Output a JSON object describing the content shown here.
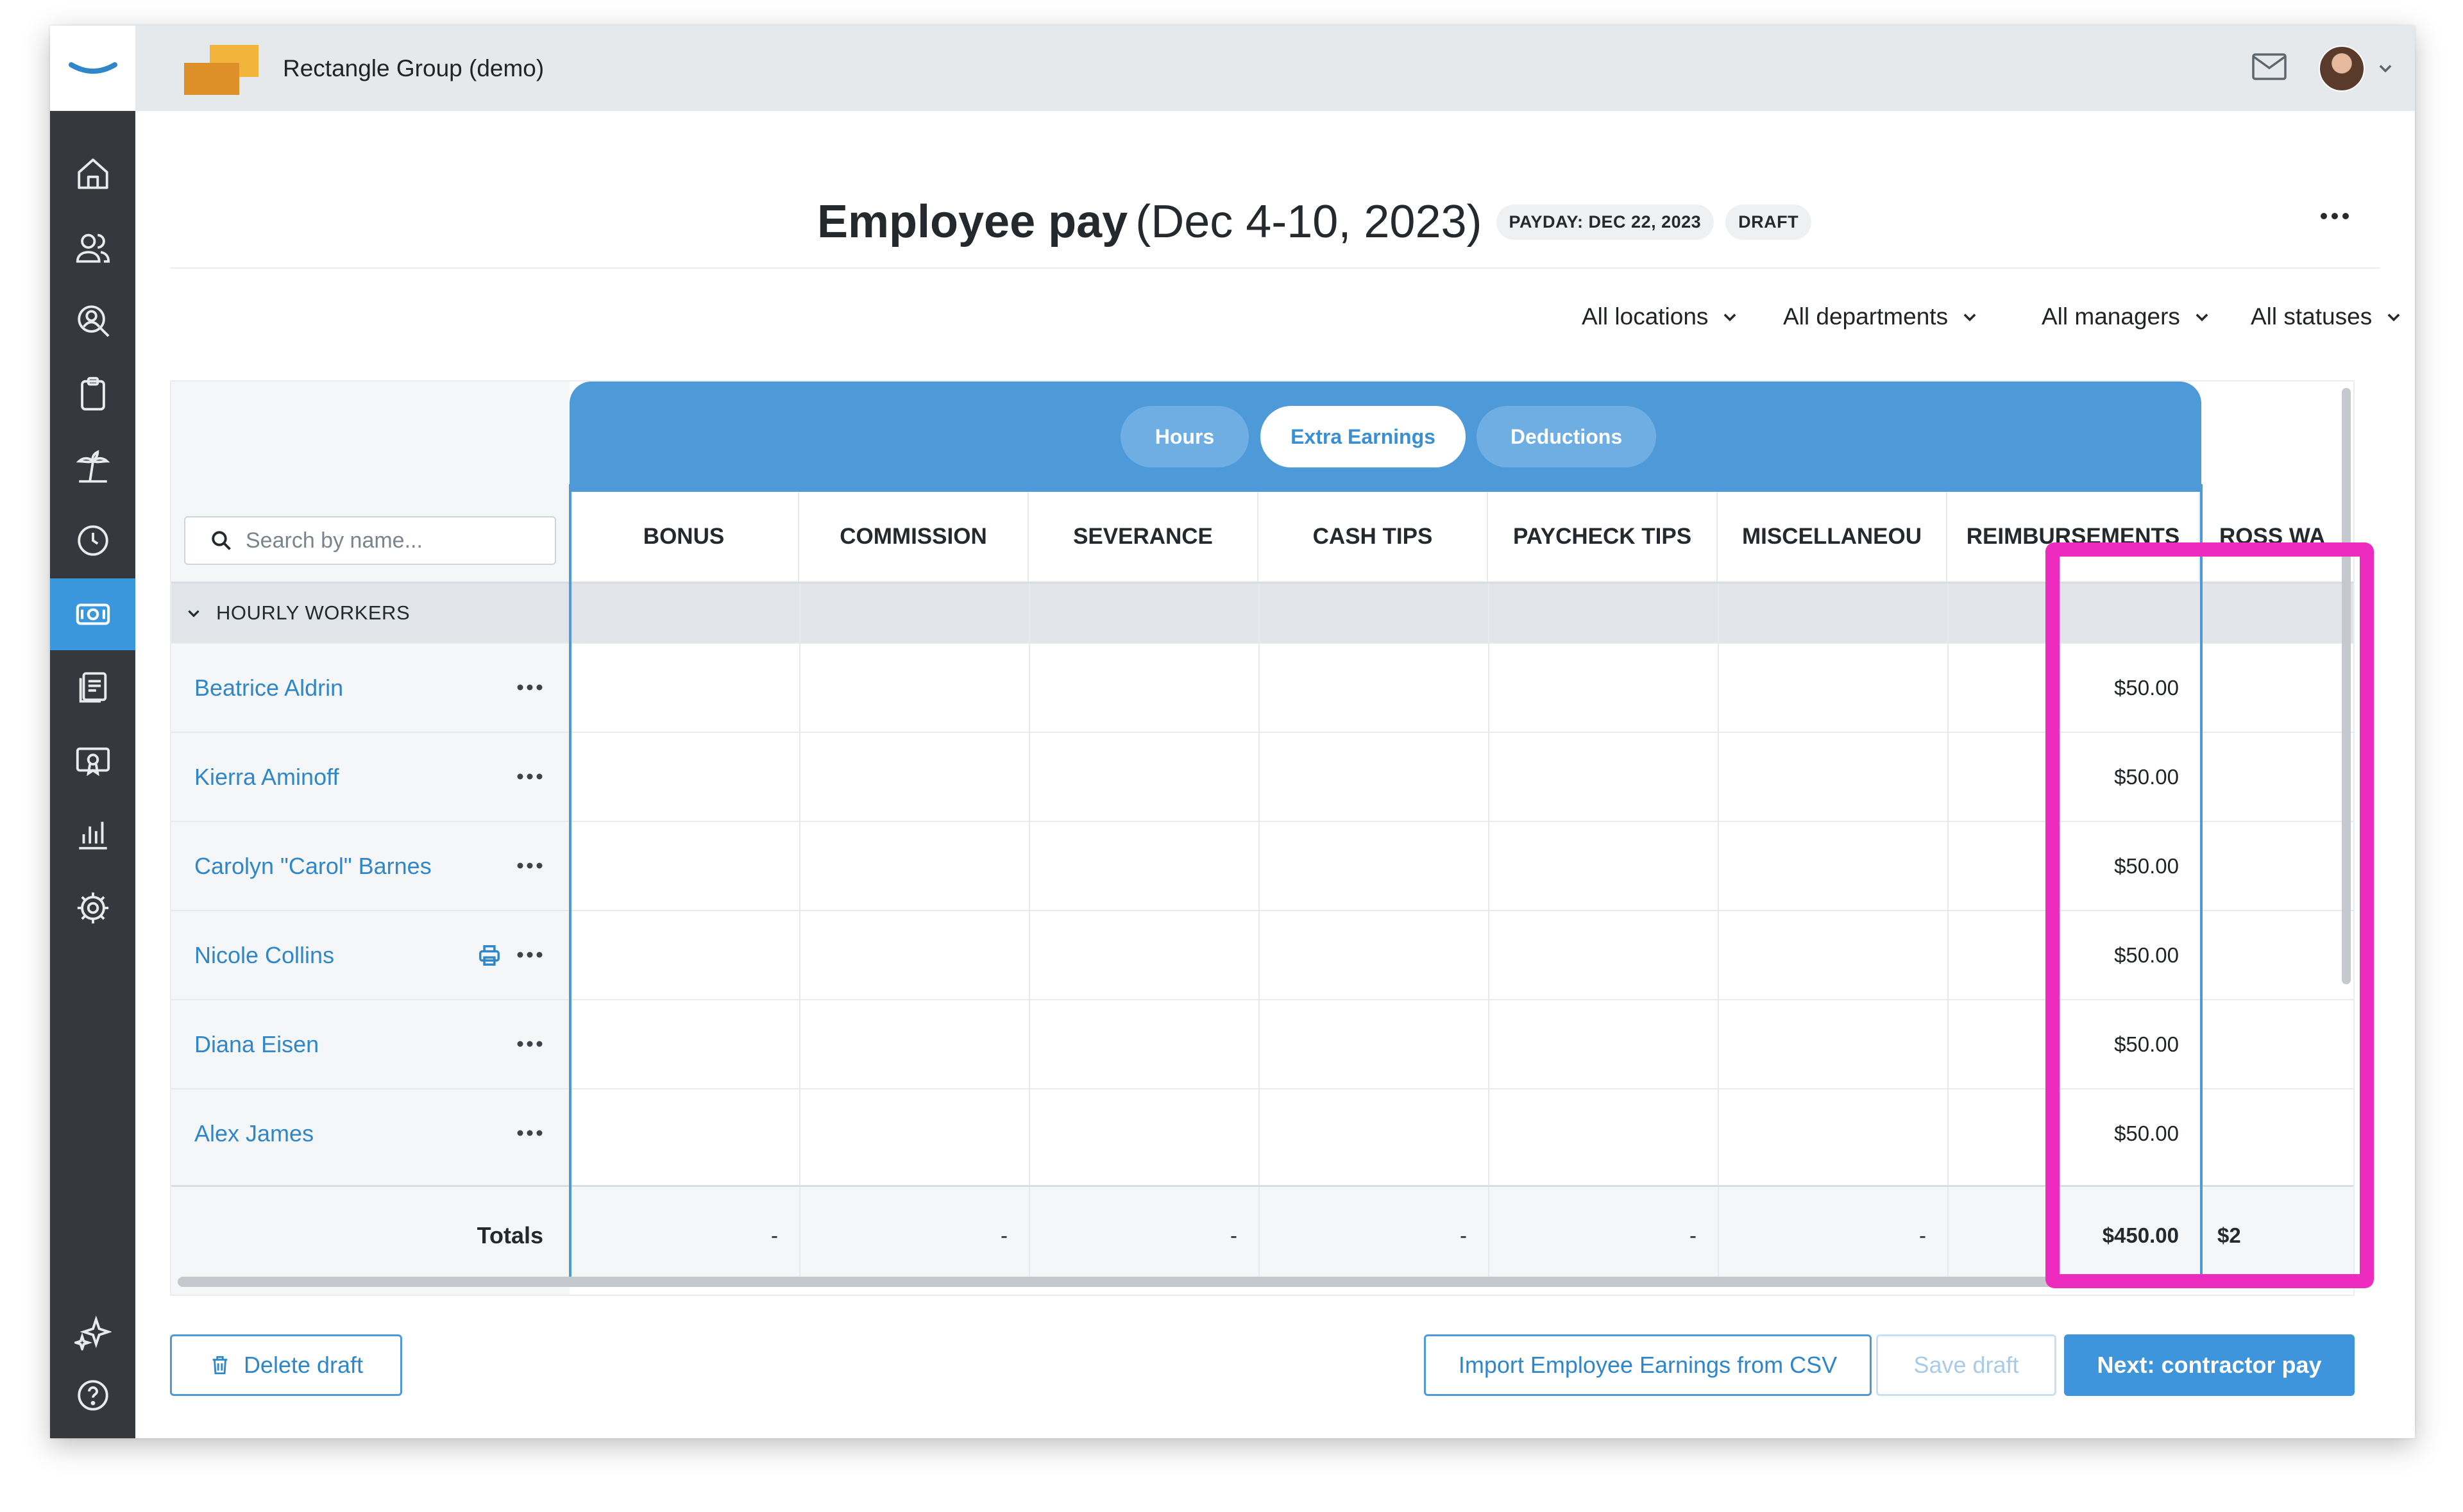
{
  "topbar": {
    "org_name": "Rectangle Group (demo)",
    "icons": [
      "mail-icon",
      "avatar",
      "chevron-down-icon"
    ]
  },
  "sidebar": {
    "items": [
      {
        "icon": "home-icon"
      },
      {
        "icon": "people-icon"
      },
      {
        "icon": "user-search-icon"
      },
      {
        "icon": "clipboard-icon"
      },
      {
        "icon": "palm-tree-icon"
      },
      {
        "icon": "clock-icon"
      },
      {
        "icon": "money-icon",
        "active": true
      },
      {
        "icon": "documents-icon"
      },
      {
        "icon": "certificate-icon"
      },
      {
        "icon": "bar-chart-icon"
      },
      {
        "icon": "gear-icon"
      },
      {
        "icon": "sparkle-icon"
      },
      {
        "icon": "help-icon"
      }
    ]
  },
  "header": {
    "title": "Employee pay",
    "date_range": "(Dec 4-10, 2023)",
    "payday_badge": "PAYDAY: DEC 22, 2023",
    "status_badge": "DRAFT"
  },
  "filters": {
    "locations": "All locations",
    "departments": "All departments",
    "managers": "All managers",
    "statuses": "All statuses"
  },
  "tabs": {
    "hours": "Hours",
    "extra_earnings": "Extra Earnings",
    "deductions": "Deductions",
    "active": "Extra Earnings"
  },
  "search": {
    "placeholder": "Search by name..."
  },
  "columns": {
    "bonus": "BONUS",
    "commission": "COMMISSION",
    "severance": "SEVERANCE",
    "cash_tips": "CASH TIPS",
    "paycheck_tips": "PAYCHECK TIPS",
    "miscellaneous": "MISCELLANEOU",
    "reimbursements": "REIMBURSEMENTS",
    "gross_wages": "ROSS WA"
  },
  "group": {
    "label": "HOURLY WORKERS"
  },
  "employees": [
    {
      "name": "Beatrice Aldrin",
      "reimbursement": "$50.00"
    },
    {
      "name": "Kierra Aminoff",
      "reimbursement": "$50.00"
    },
    {
      "name": "Carolyn \"Carol\" Barnes",
      "reimbursement": "$50.00"
    },
    {
      "name": "Nicole Collins",
      "reimbursement": "$50.00"
    },
    {
      "name": "Diana Eisen",
      "reimbursement": "$50.00"
    },
    {
      "name": "Alex James",
      "reimbursement": "$50.00"
    }
  ],
  "totals": {
    "label": "Totals",
    "bonus": "-",
    "commission": "-",
    "severance": "-",
    "cash_tips": "-",
    "paycheck_tips": "-",
    "miscellaneous": "-",
    "reimbursements": "$450.00",
    "gross_wages": "$2"
  },
  "footer": {
    "delete_draft": "Delete draft",
    "import_csv": "Import Employee Earnings from CSV",
    "save_draft": "Save draft",
    "next": "Next: contractor pay"
  },
  "colors": {
    "accent": "#3f95db",
    "highlight": "#ed2bbe",
    "sidebar": "#35393e"
  }
}
